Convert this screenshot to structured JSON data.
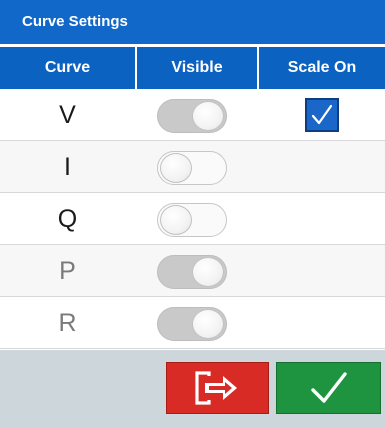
{
  "dialog": {
    "title": "Curve Settings",
    "columns": [
      "Curve",
      "Visible",
      "Scale On"
    ]
  },
  "curves": [
    {
      "name": "V",
      "visible": true,
      "scale_on": true,
      "dimmed": false
    },
    {
      "name": "I",
      "visible": false,
      "scale_on": false,
      "dimmed": false
    },
    {
      "name": "Q",
      "visible": false,
      "scale_on": false,
      "dimmed": false
    },
    {
      "name": "P",
      "visible": true,
      "scale_on": false,
      "dimmed": true
    },
    {
      "name": "R",
      "visible": true,
      "scale_on": false,
      "dimmed": true
    }
  ],
  "buttons": [
    {
      "name": "exit-button",
      "icon": "exit-door-icon",
      "color": "#d82b25"
    },
    {
      "name": "confirm-button",
      "icon": "checkmark-icon",
      "color": "#1f9440"
    }
  ],
  "colors": {
    "title_bar": "#1168c8",
    "header_bar": "#0c62c0",
    "checkbox": "#1b67c9",
    "footer": "#cdd6db"
  }
}
